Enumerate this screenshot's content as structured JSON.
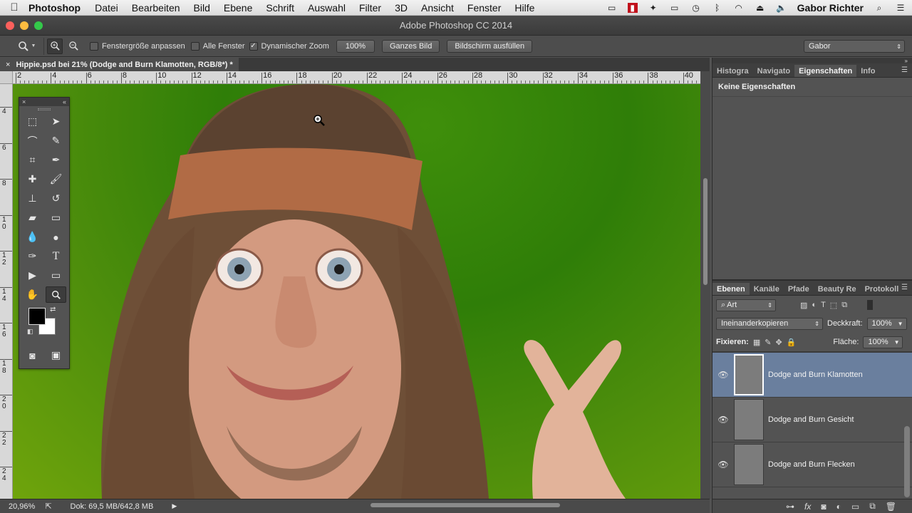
{
  "menubar": {
    "apple": "",
    "app_name": "Photoshop",
    "items": [
      "Datei",
      "Bearbeiten",
      "Bild",
      "Ebene",
      "Schrift",
      "Auswahl",
      "Filter",
      "3D",
      "Ansicht",
      "Fenster",
      "Hilfe"
    ],
    "user": "Gabor Richter"
  },
  "window": {
    "title": "Adobe Photoshop CC 2014"
  },
  "options": {
    "fit_window": "Fenstergröße anpassen",
    "all_windows": "Alle Fenster",
    "scrubby_zoom": "Dynamischer Zoom",
    "scrubby_checked": true,
    "btn_100": "100%",
    "btn_fit": "Ganzes Bild",
    "btn_fill": "Bildschirm ausfüllen",
    "workspace": "Gabor"
  },
  "document": {
    "tab_title": "Hippie.psd bei 21% (Dodge and Burn Klamotten, RGB/8*) *",
    "h_ruler": [
      "2",
      "4",
      "6",
      "8",
      "10",
      "12",
      "14",
      "16",
      "18",
      "20",
      "22",
      "24",
      "26",
      "28",
      "30",
      "32",
      "34",
      "36",
      "38",
      "40"
    ],
    "v_ruler": [
      "4",
      "6",
      "8",
      "10",
      "12",
      "14",
      "16",
      "18",
      "20",
      "22",
      "24"
    ]
  },
  "status": {
    "zoom": "20,96%",
    "doc": "Dok: 69,5 MB/642,8 MB"
  },
  "panels": {
    "top_tabs": [
      "Histogra",
      "Navigato",
      "Eigenschaften",
      "Info"
    ],
    "properties_text": "Keine Eigenschaften",
    "layer_tabs": [
      "Ebenen",
      "Kanäle",
      "Pfade",
      "Beauty Re",
      "Protokoll"
    ],
    "filter_kind": "Art",
    "blend_mode": "Ineinanderkopieren",
    "opacity_label": "Deckkraft:",
    "opacity_value": "100%",
    "lock_label": "Fixieren:",
    "fill_label": "Fläche:",
    "fill_value": "100%",
    "layers": [
      {
        "name": "Dodge and Burn Klamotten",
        "selected": true
      },
      {
        "name": "Dodge and Burn Gesicht",
        "selected": false
      },
      {
        "name": "Dodge and Burn Flecken",
        "selected": false
      }
    ]
  },
  "colors": {
    "foreground": "#000000",
    "background": "#ffffff",
    "selection": "#6a7f9e",
    "canvas_green": "#2f7e08"
  }
}
